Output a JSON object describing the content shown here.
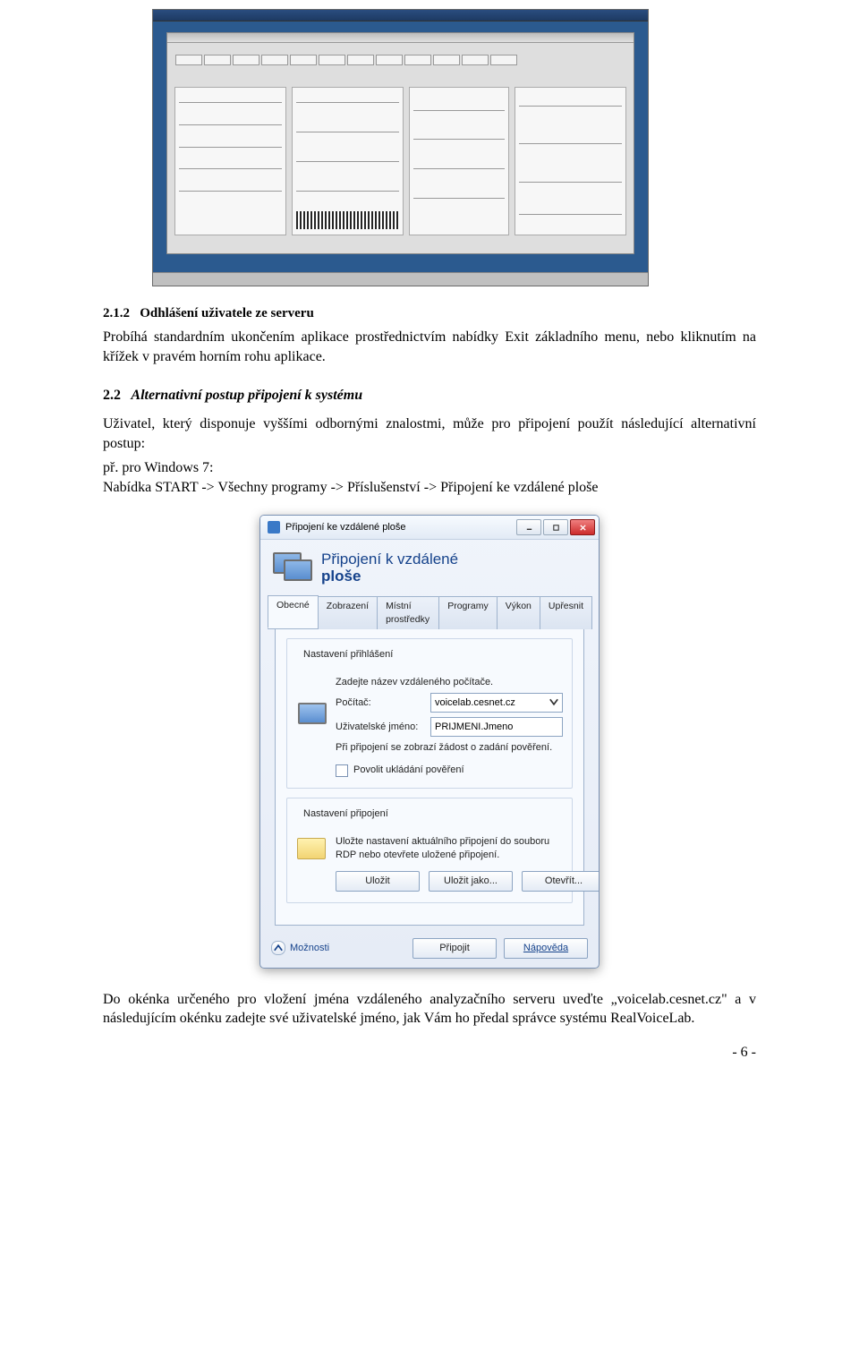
{
  "section212": {
    "title_num": "2.1.2",
    "title_text": "Odhlášení uživatele ze serveru",
    "para": "Probíhá standardním ukončením aplikace prostřednictvím nabídky Exit základního menu, nebo kliknutím na křížek v pravém horním rohu aplikace."
  },
  "section22": {
    "title_num": "2.2",
    "title_text": "Alternativní postup připojení k systému",
    "para1": "Uživatel, který disponuje vyššími odbornými znalostmi, může pro připojení použít následující alternativní postup:",
    "para2a": "př. pro Windows 7:",
    "para2b": "Nabídka START -> Všechny programy -> Příslušenství -> Připojení ke vzdálené ploše",
    "para3": "Do okénka určeného pro vložení jména vzdáleného analyzačního serveru uveďte „voicelab.cesnet.cz\" a v následujícím okénku zadejte své uživatelské jméno, jak Vám ho předal správce systému RealVoiceLab."
  },
  "rdp": {
    "window_title": "Připojení ke vzdálené ploše",
    "header_line1": "Připojení k vzdálené",
    "header_line2_bold": "ploše",
    "tabs": [
      "Obecné",
      "Zobrazení",
      "Místní prostředky",
      "Programy",
      "Výkon",
      "Upřesnit"
    ],
    "group_login": {
      "title": "Nastavení přihlášení",
      "intro": "Zadejte název vzdáleného počítače.",
      "label_host": "Počítač:",
      "value_host": "voicelab.cesnet.cz",
      "label_user": "Uživatelské jméno:",
      "value_user": "PRIJMENI.Jmeno",
      "note": "Při připojení se zobrazí žádost o zadání pověření.",
      "checkbox": "Povolit ukládání pověření"
    },
    "group_conn": {
      "title": "Nastavení připojení",
      "intro": "Uložte nastavení aktuálního připojení do souboru RDP nebo otevřete uložené připojení.",
      "btn_save": "Uložit",
      "btn_saveas": "Uložit jako...",
      "btn_open": "Otevřít..."
    },
    "footer": {
      "options": "Možnosti",
      "connect": "Připojit",
      "help": "Nápověda"
    }
  },
  "pagenum": "- 6 -"
}
